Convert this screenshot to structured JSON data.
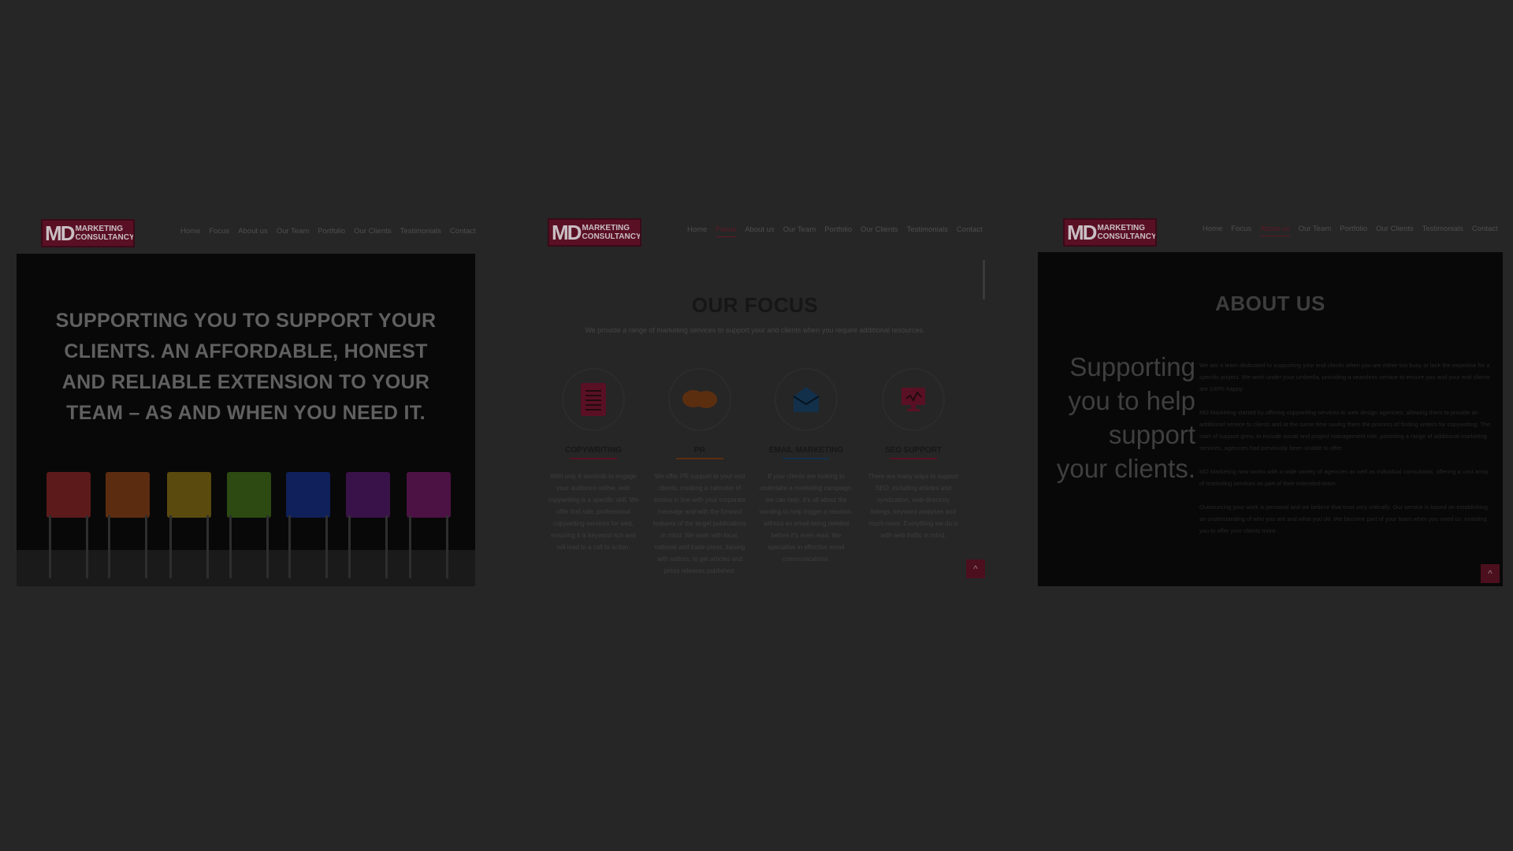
{
  "logo": {
    "md": "MD",
    "line1": "MARKETING",
    "line2": "CONSULTANCY"
  },
  "nav": [
    "Home",
    "Focus",
    "About us",
    "Our Team",
    "Portfolio",
    "Our Clients",
    "Testimonials",
    "Contact"
  ],
  "hero": {
    "headline": "SUPPORTING YOU TO SUPPORT YOUR CLIENTS. AN AFFORDABLE, HONEST AND RELIABLE EXTENSION TO YOUR TEAM – AS AND WHEN YOU NEED IT.",
    "chair_colors": [
      "#5c1a1a",
      "#5c2c10",
      "#5a4a0e",
      "#2c4a12",
      "#10205a",
      "#3a124a",
      "#4c1244"
    ]
  },
  "focus": {
    "title": "OUR FOCUS",
    "subtitle": "We provide a range of marketing services to support your and clients when you require additional resources.",
    "columns": [
      {
        "icon": "notebook-icon",
        "color": "#5a1024",
        "title": "COPYWRITING",
        "text": "With only 8 seconds to engage your audience online, web copywriting is a specific skill. We offer first rate, professional copywriting services for web, ensuring it is keyword rich and will lead to a call to action."
      },
      {
        "icon": "speech-bubbles-icon",
        "color": "#5c2e10",
        "title": "PR",
        "text": "We offer PR support to your end clients, creating a calendar of stories in line with your corporate message and with the forward features of the target publications in mind. We work with local, national and trade press, liaising with editors, to get articles and press releases published."
      },
      {
        "icon": "envelope-icon",
        "color": "#12304a",
        "title": "EMAIL MARKETING",
        "text": "If your clients are looking to undertake a marketing campaign, we can help. It's all about the wording to help trigger a reaction, without an email being deleted before it's even read. We specialise in effective email communications."
      },
      {
        "icon": "monitor-chart-icon",
        "color": "#5a1024",
        "title": "SEO SUPPORT",
        "text": "There are many ways to support SEO, including articles and syndication, web directory listings, keyword analyses and much more. Everything we do is with web traffic in mind."
      }
    ]
  },
  "about": {
    "title": "ABOUT US",
    "tagline": "Supporting you to help support your clients.",
    "paragraphs": [
      "We are a team dedicated to supporting your end clients when you are either too busy or lack the expertise for a specific project. We work under your umbrella, providing a seamless service to ensure you and your end clients are 100% happy.",
      "MD Marketing started by offering copywriting services to web design agencies, allowing them to provide an additional service to clients and at the same time saving them the process of finding writers for copywriting. The start of support grew, to include social and project management role, providing a range of additional marketing services, agencies had previously been unable to offer.",
      "MD Marketing now works with a wide variety of agencies as well as individual consultants, offering a vast array of marketing services as part of their extended team.",
      "Outsourcing your work is personal and we believe that trust very critically. Our service is based on establishing an understanding of who you are and what you do. We become part of your team when you need us, enabling you to offer your clients more."
    ]
  },
  "back_to_top": "^"
}
